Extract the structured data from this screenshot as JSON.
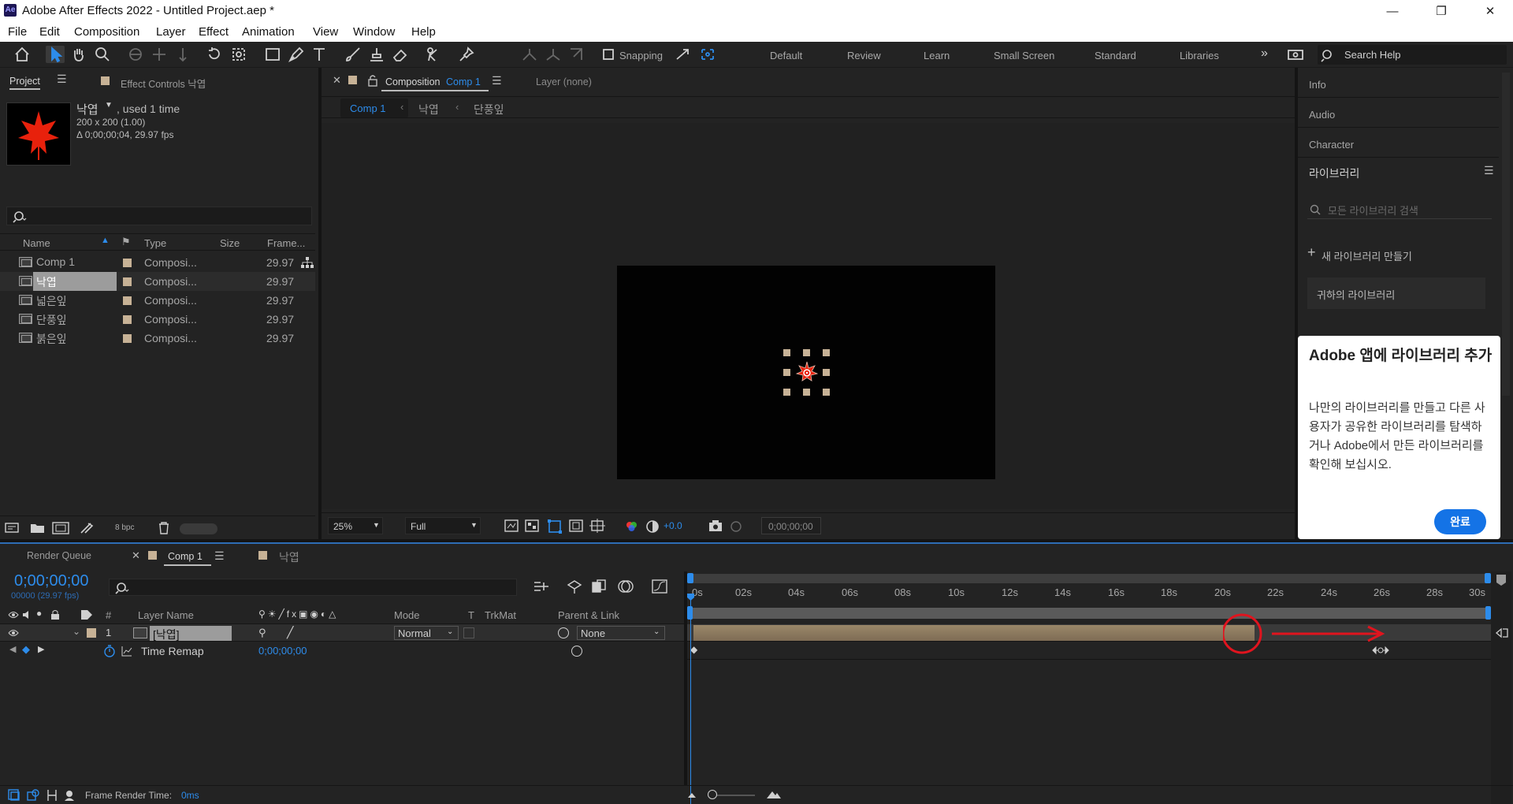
{
  "titlebar": {
    "title": "Adobe After Effects 2022 - Untitled Project.aep *",
    "app_icon": "Ae"
  },
  "menu": [
    "File",
    "Edit",
    "Composition",
    "Layer",
    "Effect",
    "Animation",
    "View",
    "Window",
    "Help"
  ],
  "toolbar": {
    "snapping_label": "Snapping",
    "workspaces": [
      "Default",
      "Review",
      "Learn",
      "Small Screen",
      "Standard",
      "Libraries"
    ],
    "more_label": "»",
    "search_placeholder": "Search Help"
  },
  "project": {
    "tab_project": "Project",
    "tab_effect_controls": "Effect Controls 낙엽",
    "preview": {
      "name": "낙엽",
      "used": ", used 1 time",
      "dimensions": "200 x 200 (1.00)",
      "duration": "Δ 0;00;00;04, 29.97 fps"
    },
    "columns": {
      "name": "Name",
      "type": "Type",
      "size": "Size",
      "frame": "Frame..."
    },
    "items": [
      {
        "name": "Comp 1",
        "type": "Composi...",
        "frame": "29.97"
      },
      {
        "name": "낙엽",
        "type": "Composi...",
        "frame": "29.97"
      },
      {
        "name": "넓은잎",
        "type": "Composi...",
        "frame": "29.97"
      },
      {
        "name": "단풍잎",
        "type": "Composi...",
        "frame": "29.97"
      },
      {
        "name": "붉은잎",
        "type": "Composi...",
        "frame": "29.97"
      }
    ],
    "bpc": "8 bpc"
  },
  "composition": {
    "tab_label": "Composition",
    "tab_comp": "Comp 1",
    "layer_tab": "Layer (none)",
    "breadcrumbs": [
      "Comp 1",
      "낙엽",
      "단풍잎"
    ],
    "zoom": "25%",
    "resolution": "Full",
    "exposure": "+0.0",
    "timecode": "0;00;00;00"
  },
  "right_panel": {
    "items": [
      "Info",
      "Audio",
      "Character"
    ],
    "libraries_title": "라이브러리",
    "search_placeholder": "모든 라이브러리 검색",
    "new_library": "새 라이브러리 만들기",
    "your_library": "귀하의 라이브러리",
    "popup": {
      "title": "Adobe 앱에 라이브러리 추가",
      "body": "나만의 라이브러리를 만들고 다른 사용자가 공유한 라이브러리를 탐색하거나 Adobe에서 만든 라이브러리를 확인해 보십시오.",
      "done": "완료"
    }
  },
  "timeline": {
    "tabs": [
      "Render Queue",
      "Comp 1",
      "낙엽"
    ],
    "timecode": "0;00;00;00",
    "fps": "00000 (29.97 fps)",
    "columns": {
      "num": "#",
      "layer_name": "Layer Name",
      "mode": "Mode",
      "t": "T",
      "trkmat": "TrkMat",
      "parent": "Parent & Link"
    },
    "layer": {
      "num": "1",
      "name": "[낙엽]",
      "mode": "Normal",
      "parent": "None"
    },
    "property": {
      "name": "Time Remap",
      "value": "0;00;00;00"
    },
    "ruler": [
      "0s",
      "02s",
      "04s",
      "06s",
      "08s",
      "10s",
      "12s",
      "14s",
      "16s",
      "18s",
      "20s",
      "22s",
      "24s",
      "26s",
      "28s",
      "30s"
    ],
    "layer_bar_end_seconds": 21.1,
    "status": "Frame Render Time:",
    "status_value": "0ms"
  },
  "colors": {
    "accent": "#2d8ceb",
    "label": "#c7b296",
    "annotation": "#e0141e",
    "layer_bar": "#8e7b63"
  }
}
